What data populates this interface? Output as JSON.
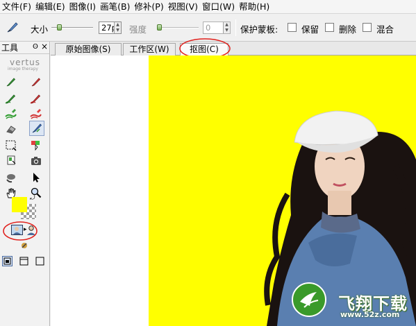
{
  "menu": [
    "文件(F)",
    "编辑(E)",
    "图像(I)",
    "画笔(B)",
    "修补(P)",
    "视图(V)",
    "窗口(W)",
    "帮助(H)"
  ],
  "options": {
    "size_label": "大小",
    "size_value": "27px",
    "size_level": 0.15,
    "strength_label": "强度",
    "strength_value": "0",
    "strength_level": 0.0,
    "mask_label": "保护蒙板:",
    "keep_label": "保留",
    "delete_label": "删除",
    "mix_label": "混合"
  },
  "tools": {
    "title": "工具",
    "pin_symbol": "ð",
    "close_symbol": "×",
    "logo_name": "vertus",
    "logo_sub": "image therapy"
  },
  "tabs": [
    {
      "label": "原始图像(S)",
      "active": false
    },
    {
      "label": "工作区(W)",
      "active": false
    },
    {
      "label": "抠图(C)",
      "active": true
    }
  ],
  "colors": {
    "foreground": "#ffff00",
    "canvas_bg": "#ffff00",
    "annotation": "#e0201c"
  },
  "watermark": {
    "text": "飞翔下载",
    "url": "www.52z.com"
  }
}
